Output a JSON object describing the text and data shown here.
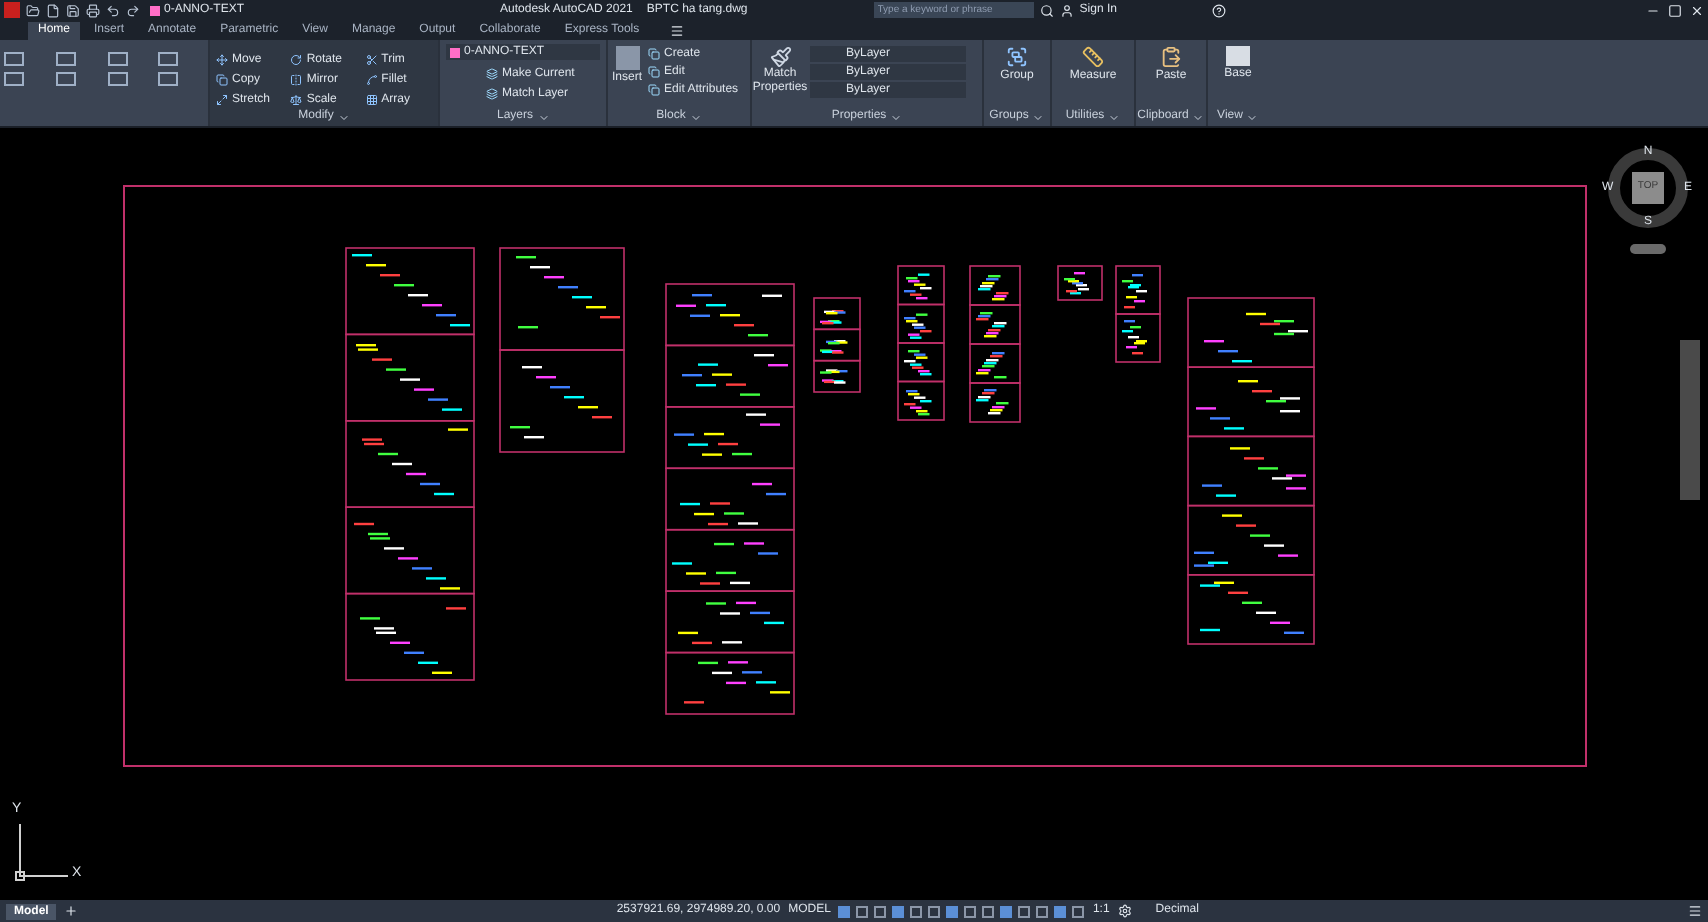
{
  "title_bar": {
    "layer": "0-ANNO-TEXT",
    "app_title": "Autodesk AutoCAD 2021",
    "file": "BPTC ha tang.dwg",
    "search_placeholder": "Type a keyword or phrase",
    "sign_in": "Sign In"
  },
  "tabs": [
    {
      "label": "Home",
      "selected": true
    },
    {
      "label": "Insert",
      "selected": false
    },
    {
      "label": "Annotate",
      "selected": false
    },
    {
      "label": "Parametric",
      "selected": false
    },
    {
      "label": "View",
      "selected": false
    },
    {
      "label": "Manage",
      "selected": false
    },
    {
      "label": "Output",
      "selected": false
    },
    {
      "label": "Collaborate",
      "selected": false
    },
    {
      "label": "Express Tools",
      "selected": false
    }
  ],
  "modify": {
    "tools": [
      "Move",
      "Rotate",
      "Trim",
      "Copy",
      "Mirror",
      "Fillet",
      "Stretch",
      "Scale",
      "Array"
    ],
    "label": "Modify"
  },
  "layers": {
    "layer": "0-ANNO-TEXT",
    "tools": [
      "Make Current",
      "Match Layer"
    ],
    "label": "Layers"
  },
  "block": {
    "insert": "Insert",
    "tools": [
      "Create",
      "Edit",
      "Edit Attributes"
    ],
    "label": "Block"
  },
  "properties": {
    "match": "Match Properties",
    "values": [
      "ByLayer",
      "ByLayer",
      "ByLayer"
    ],
    "label": "Properties"
  },
  "groups": {
    "tool": "Group",
    "label": "Groups"
  },
  "utilities": {
    "tool": "Measure",
    "label": "Utilities"
  },
  "clipboard": {
    "tool": "Paste",
    "label": "Clipboard"
  },
  "view": {
    "tool": "Base",
    "label": "View"
  },
  "viewcube": {
    "north": "N",
    "south": "S",
    "east": "E",
    "west": "W",
    "face": "TOP"
  },
  "ucs": {
    "x": "X",
    "y": "Y"
  },
  "status_bar": {
    "layouts": [
      {
        "label": "Model",
        "selected": true
      }
    ],
    "coordinates": "2537921.69, 2974989.20, 0.00",
    "space": "MODEL",
    "scale": "1:1",
    "units": "Decimal"
  }
}
